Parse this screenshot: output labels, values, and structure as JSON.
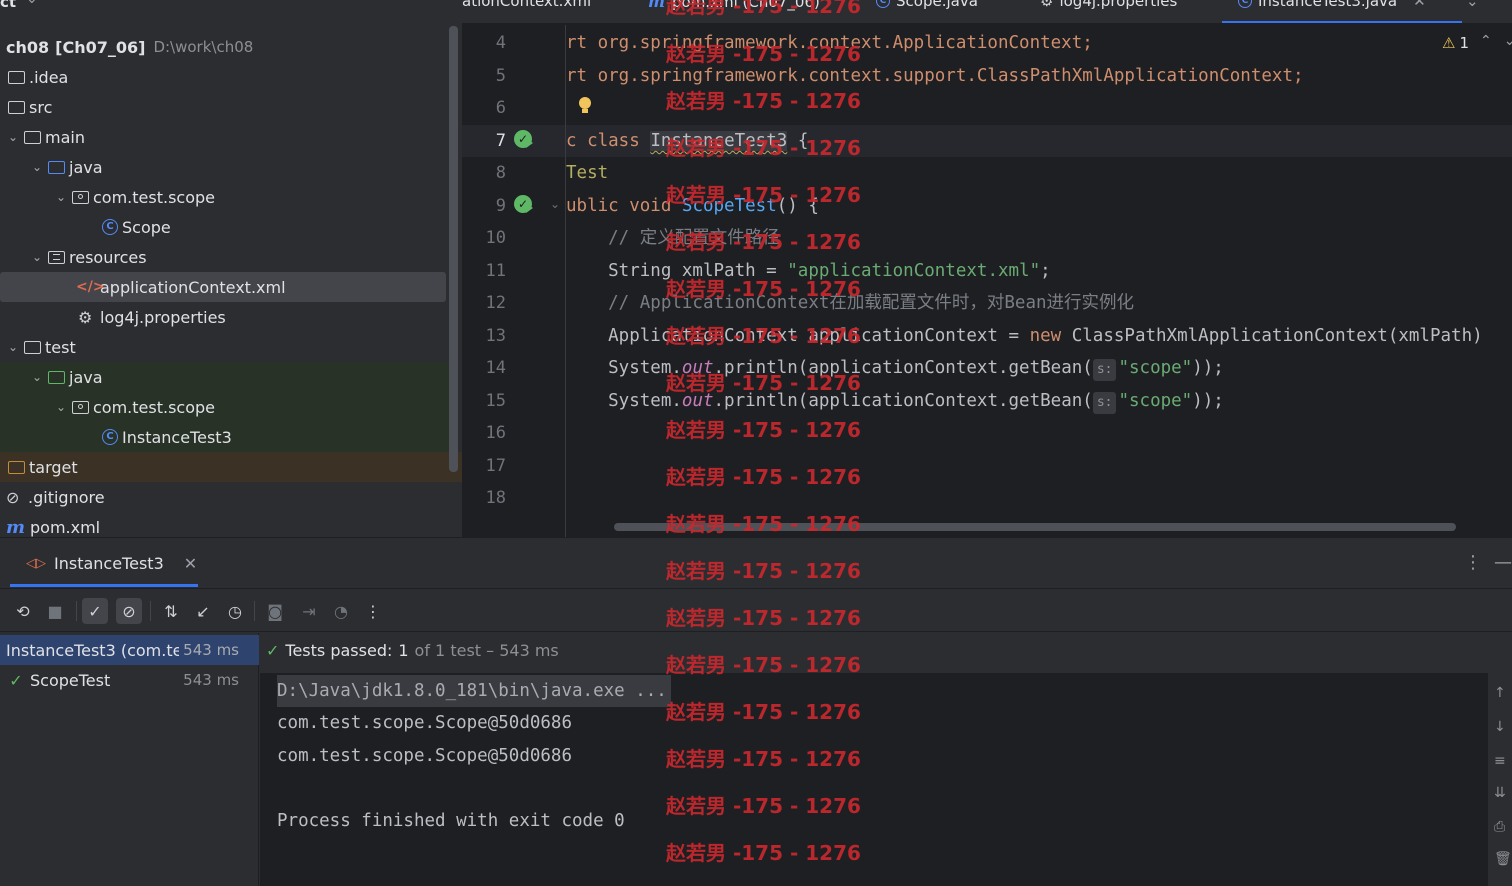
{
  "project": {
    "header": "ct",
    "items": [
      {
        "name": "ch08",
        "module": "[Ch07_06]",
        "path": "D:\\work\\ch08"
      },
      {
        "name": ".idea"
      },
      {
        "name": "src"
      },
      {
        "name": "main"
      },
      {
        "name": "java"
      },
      {
        "name": "com.test.scope"
      },
      {
        "name": "Scope"
      },
      {
        "name": "resources"
      },
      {
        "name": "applicationContext.xml"
      },
      {
        "name": "log4j.properties"
      },
      {
        "name": "test"
      },
      {
        "name": "java"
      },
      {
        "name": "com.test.scope"
      },
      {
        "name": "InstanceTest3"
      },
      {
        "name": "target"
      },
      {
        "name": ".gitignore"
      },
      {
        "name": "pom.xml"
      }
    ]
  },
  "tabs": [
    {
      "label": "ationContext.xml"
    },
    {
      "label": "pom.xml (Ch07_06)"
    },
    {
      "label": "Scope.java"
    },
    {
      "label": "log4j.properties"
    },
    {
      "label": "InstanceTest3.java"
    }
  ],
  "editor": {
    "warning_count": "1",
    "lines": [
      {
        "n": "4",
        "text": "rt org.springframework.context.ApplicationContext;"
      },
      {
        "n": "5",
        "text": "rt org.springframework.context.support.ClassPathXmlApplicationContext;"
      },
      {
        "n": "6",
        "text": ""
      },
      {
        "n": "7",
        "kw": "c class",
        "name": "InstanceTest3",
        "rest": " {"
      },
      {
        "n": "8",
        "text": "Test"
      },
      {
        "n": "9",
        "kw": "ublic void",
        "name": "ScopeTest",
        "rest": "() {"
      },
      {
        "n": "10",
        "text": "    // 定义配置文件路径"
      },
      {
        "n": "11",
        "pre": "    String xmlPath = ",
        "str": "\"applicationContext.xml\"",
        "post": ";"
      },
      {
        "n": "12",
        "text": "    // ApplicationContext在加载配置文件时，对Bean进行实例化"
      },
      {
        "n": "13",
        "pre": "    ApplicationContext applicationContext = ",
        "kw": "new",
        "post": " ClassPathXmlApplicationContext(xmlPath)"
      },
      {
        "n": "14",
        "pre": "    System.",
        "field": "out",
        "mid": ".println(applicationContext.getBean(",
        "hint": "s:",
        "str": "\"scope\"",
        "post": "));"
      },
      {
        "n": "15",
        "pre": "    System.",
        "field": "out",
        "mid": ".println(applicationContext.getBean(",
        "hint": "s:",
        "str": "\"scope\"",
        "post": "));"
      },
      {
        "n": "16",
        "text": ""
      },
      {
        "n": "17",
        "text": ""
      },
      {
        "n": "18",
        "text": ""
      }
    ]
  },
  "run": {
    "tab_label": "InstanceTest3",
    "results": [
      {
        "label": "InstanceTest3 (com.te:",
        "time": "543 ms"
      },
      {
        "label": "ScopeTest",
        "time": "543 ms"
      }
    ],
    "status": {
      "prefix": "Tests passed:",
      "count": "1",
      "suffix": "of 1 test – 543 ms"
    },
    "output": [
      "D:\\Java\\jdk1.8.0_181\\bin\\java.exe ...",
      "com.test.scope.Scope@50d0686",
      "com.test.scope.Scope@50d0686",
      "",
      "Process finished with exit code 0"
    ]
  },
  "watermark": "赵若男 -175 - 1276",
  "colors": {
    "accent": "#3574f0",
    "success": "#5fb865",
    "watermark": "#c8282d"
  }
}
